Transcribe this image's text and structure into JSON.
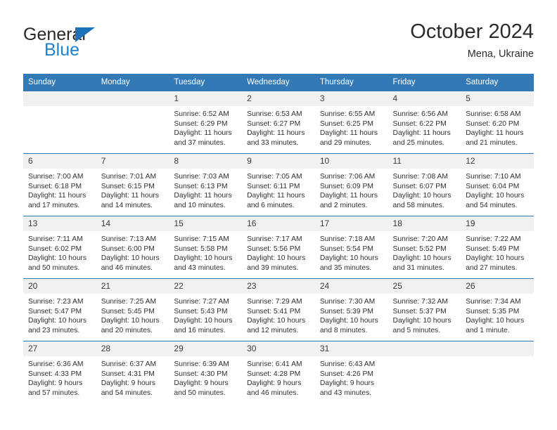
{
  "brand": {
    "name_part1": "General",
    "name_part2": "Blue",
    "triangle_icon": "brand-triangle-icon",
    "colors": {
      "dark": "#27282a",
      "blue": "#1a82d2",
      "triangle": "#1a72ba"
    }
  },
  "header": {
    "title": "October 2024",
    "location": "Mena, Ukraine"
  },
  "calendar": {
    "accent_color": "#3379b5",
    "daynum_bg": "#f1f1f1",
    "weekday_headers": [
      "Sunday",
      "Monday",
      "Tuesday",
      "Wednesday",
      "Thursday",
      "Friday",
      "Saturday"
    ],
    "weeks": [
      [
        {
          "day": "",
          "sunrise": "",
          "sunset": "",
          "daylight": ""
        },
        {
          "day": "",
          "sunrise": "",
          "sunset": "",
          "daylight": ""
        },
        {
          "day": "1",
          "sunrise": "Sunrise: 6:52 AM",
          "sunset": "Sunset: 6:29 PM",
          "daylight": "Daylight: 11 hours and 37 minutes."
        },
        {
          "day": "2",
          "sunrise": "Sunrise: 6:53 AM",
          "sunset": "Sunset: 6:27 PM",
          "daylight": "Daylight: 11 hours and 33 minutes."
        },
        {
          "day": "3",
          "sunrise": "Sunrise: 6:55 AM",
          "sunset": "Sunset: 6:25 PM",
          "daylight": "Daylight: 11 hours and 29 minutes."
        },
        {
          "day": "4",
          "sunrise": "Sunrise: 6:56 AM",
          "sunset": "Sunset: 6:22 PM",
          "daylight": "Daylight: 11 hours and 25 minutes."
        },
        {
          "day": "5",
          "sunrise": "Sunrise: 6:58 AM",
          "sunset": "Sunset: 6:20 PM",
          "daylight": "Daylight: 11 hours and 21 minutes."
        }
      ],
      [
        {
          "day": "6",
          "sunrise": "Sunrise: 7:00 AM",
          "sunset": "Sunset: 6:18 PM",
          "daylight": "Daylight: 11 hours and 17 minutes."
        },
        {
          "day": "7",
          "sunrise": "Sunrise: 7:01 AM",
          "sunset": "Sunset: 6:15 PM",
          "daylight": "Daylight: 11 hours and 14 minutes."
        },
        {
          "day": "8",
          "sunrise": "Sunrise: 7:03 AM",
          "sunset": "Sunset: 6:13 PM",
          "daylight": "Daylight: 11 hours and 10 minutes."
        },
        {
          "day": "9",
          "sunrise": "Sunrise: 7:05 AM",
          "sunset": "Sunset: 6:11 PM",
          "daylight": "Daylight: 11 hours and 6 minutes."
        },
        {
          "day": "10",
          "sunrise": "Sunrise: 7:06 AM",
          "sunset": "Sunset: 6:09 PM",
          "daylight": "Daylight: 11 hours and 2 minutes."
        },
        {
          "day": "11",
          "sunrise": "Sunrise: 7:08 AM",
          "sunset": "Sunset: 6:07 PM",
          "daylight": "Daylight: 10 hours and 58 minutes."
        },
        {
          "day": "12",
          "sunrise": "Sunrise: 7:10 AM",
          "sunset": "Sunset: 6:04 PM",
          "daylight": "Daylight: 10 hours and 54 minutes."
        }
      ],
      [
        {
          "day": "13",
          "sunrise": "Sunrise: 7:11 AM",
          "sunset": "Sunset: 6:02 PM",
          "daylight": "Daylight: 10 hours and 50 minutes."
        },
        {
          "day": "14",
          "sunrise": "Sunrise: 7:13 AM",
          "sunset": "Sunset: 6:00 PM",
          "daylight": "Daylight: 10 hours and 46 minutes."
        },
        {
          "day": "15",
          "sunrise": "Sunrise: 7:15 AM",
          "sunset": "Sunset: 5:58 PM",
          "daylight": "Daylight: 10 hours and 43 minutes."
        },
        {
          "day": "16",
          "sunrise": "Sunrise: 7:17 AM",
          "sunset": "Sunset: 5:56 PM",
          "daylight": "Daylight: 10 hours and 39 minutes."
        },
        {
          "day": "17",
          "sunrise": "Sunrise: 7:18 AM",
          "sunset": "Sunset: 5:54 PM",
          "daylight": "Daylight: 10 hours and 35 minutes."
        },
        {
          "day": "18",
          "sunrise": "Sunrise: 7:20 AM",
          "sunset": "Sunset: 5:52 PM",
          "daylight": "Daylight: 10 hours and 31 minutes."
        },
        {
          "day": "19",
          "sunrise": "Sunrise: 7:22 AM",
          "sunset": "Sunset: 5:49 PM",
          "daylight": "Daylight: 10 hours and 27 minutes."
        }
      ],
      [
        {
          "day": "20",
          "sunrise": "Sunrise: 7:23 AM",
          "sunset": "Sunset: 5:47 PM",
          "daylight": "Daylight: 10 hours and 23 minutes."
        },
        {
          "day": "21",
          "sunrise": "Sunrise: 7:25 AM",
          "sunset": "Sunset: 5:45 PM",
          "daylight": "Daylight: 10 hours and 20 minutes."
        },
        {
          "day": "22",
          "sunrise": "Sunrise: 7:27 AM",
          "sunset": "Sunset: 5:43 PM",
          "daylight": "Daylight: 10 hours and 16 minutes."
        },
        {
          "day": "23",
          "sunrise": "Sunrise: 7:29 AM",
          "sunset": "Sunset: 5:41 PM",
          "daylight": "Daylight: 10 hours and 12 minutes."
        },
        {
          "day": "24",
          "sunrise": "Sunrise: 7:30 AM",
          "sunset": "Sunset: 5:39 PM",
          "daylight": "Daylight: 10 hours and 8 minutes."
        },
        {
          "day": "25",
          "sunrise": "Sunrise: 7:32 AM",
          "sunset": "Sunset: 5:37 PM",
          "daylight": "Daylight: 10 hours and 5 minutes."
        },
        {
          "day": "26",
          "sunrise": "Sunrise: 7:34 AM",
          "sunset": "Sunset: 5:35 PM",
          "daylight": "Daylight: 10 hours and 1 minute."
        }
      ],
      [
        {
          "day": "27",
          "sunrise": "Sunrise: 6:36 AM",
          "sunset": "Sunset: 4:33 PM",
          "daylight": "Daylight: 9 hours and 57 minutes."
        },
        {
          "day": "28",
          "sunrise": "Sunrise: 6:37 AM",
          "sunset": "Sunset: 4:31 PM",
          "daylight": "Daylight: 9 hours and 54 minutes."
        },
        {
          "day": "29",
          "sunrise": "Sunrise: 6:39 AM",
          "sunset": "Sunset: 4:30 PM",
          "daylight": "Daylight: 9 hours and 50 minutes."
        },
        {
          "day": "30",
          "sunrise": "Sunrise: 6:41 AM",
          "sunset": "Sunset: 4:28 PM",
          "daylight": "Daylight: 9 hours and 46 minutes."
        },
        {
          "day": "31",
          "sunrise": "Sunrise: 6:43 AM",
          "sunset": "Sunset: 4:26 PM",
          "daylight": "Daylight: 9 hours and 43 minutes."
        },
        {
          "day": "",
          "sunrise": "",
          "sunset": "",
          "daylight": ""
        },
        {
          "day": "",
          "sunrise": "",
          "sunset": "",
          "daylight": ""
        }
      ]
    ]
  }
}
